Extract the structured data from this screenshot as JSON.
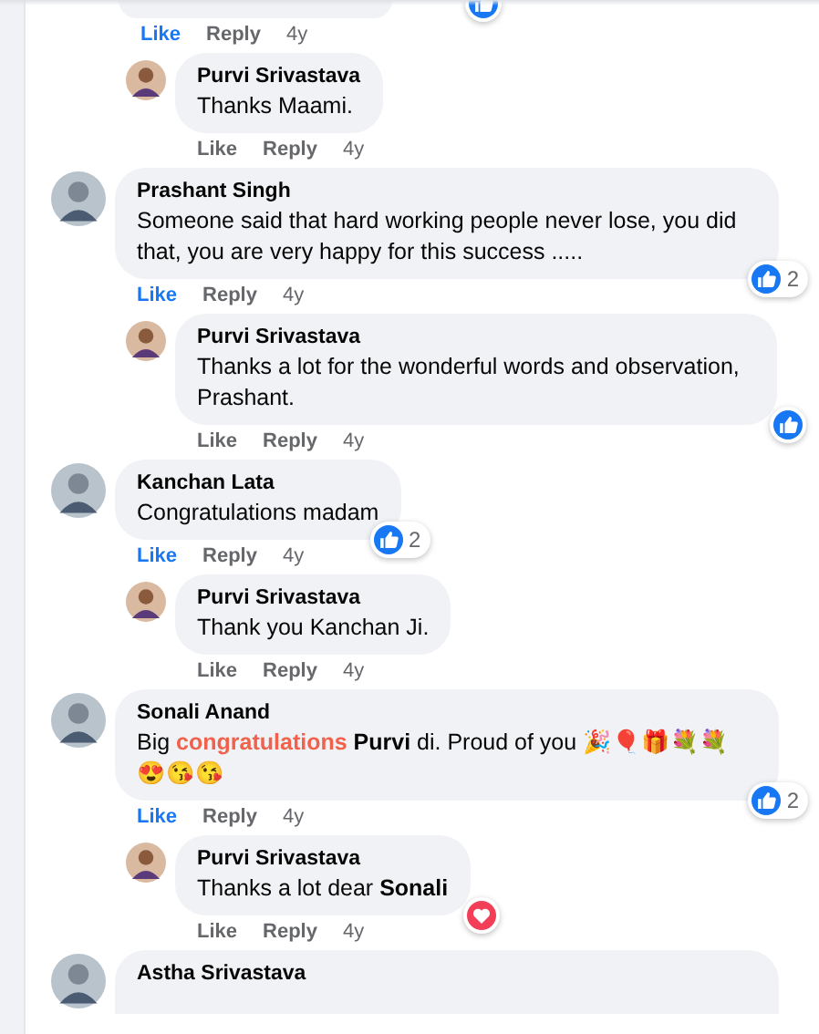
{
  "comments": [
    {
      "liked": true,
      "like_label": "Like",
      "reply_label": "Reply",
      "age": "4y",
      "reaction": {
        "kind": "like"
      },
      "children": [
        {
          "name": "Purvi Srivastava",
          "body": [
            {
              "kind": "plain",
              "t": "Thanks Maami."
            }
          ],
          "liked": false,
          "like_label": "Like",
          "reply_label": "Reply",
          "age": "4y"
        }
      ]
    },
    {
      "name": "Prashant Singh",
      "body": [
        {
          "kind": "plain",
          "t": "Someone said that hard working people never lose, you did that, you are very happy for this success ....."
        }
      ],
      "liked": true,
      "like_label": "Like",
      "reply_label": "Reply",
      "age": "4y",
      "reaction": {
        "kind": "like",
        "count": "2"
      },
      "children": [
        {
          "name": "Purvi Srivastava",
          "body": [
            {
              "kind": "plain",
              "t": "Thanks a lot for the wonderful words and observation, Prashant."
            }
          ],
          "liked": false,
          "like_label": "Like",
          "reply_label": "Reply",
          "age": "4y",
          "reaction": {
            "kind": "like"
          }
        }
      ]
    },
    {
      "name": "Kanchan Lata",
      "body": [
        {
          "kind": "plain",
          "t": "Congratulations madam"
        }
      ],
      "liked": true,
      "like_label": "Like",
      "reply_label": "Reply",
      "age": "4y",
      "reaction": {
        "kind": "like",
        "count": "2"
      },
      "children": [
        {
          "name": "Purvi Srivastava",
          "body": [
            {
              "kind": "plain",
              "t": "Thank you Kanchan Ji."
            }
          ],
          "liked": false,
          "like_label": "Like",
          "reply_label": "Reply",
          "age": "4y"
        }
      ]
    },
    {
      "name": "Sonali Anand",
      "body": [
        {
          "kind": "plain",
          "t": "Big "
        },
        {
          "kind": "highlight",
          "t": "congratulations "
        },
        {
          "kind": "mention",
          "t": "Purvi"
        },
        {
          "kind": "plain",
          "t": " di. Proud of you 🎉🎈🎁💐💐😍😘😘"
        }
      ],
      "liked": true,
      "like_label": "Like",
      "reply_label": "Reply",
      "age": "4y",
      "reaction": {
        "kind": "like",
        "count": "2"
      },
      "children": [
        {
          "name": "Purvi Srivastava",
          "body": [
            {
              "kind": "plain",
              "t": "Thanks a lot dear "
            },
            {
              "kind": "mention",
              "t": "Sonali"
            }
          ],
          "liked": false,
          "like_label": "Like",
          "reply_label": "Reply",
          "age": "4y",
          "reaction": {
            "kind": "love"
          }
        }
      ]
    },
    {
      "name": "Astha Srivastava"
    }
  ]
}
